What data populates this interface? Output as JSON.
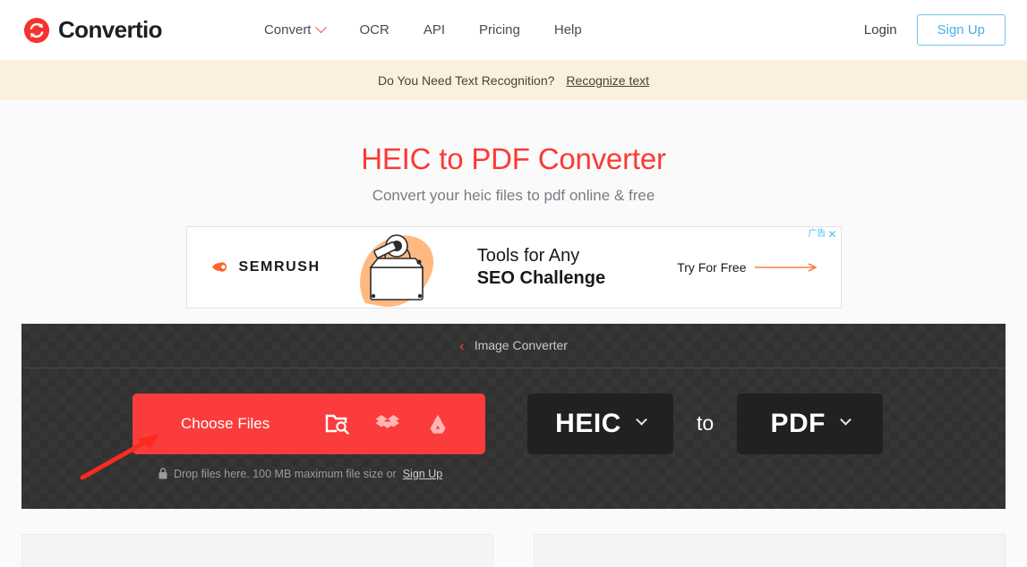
{
  "header": {
    "brand": "Convertio",
    "brand_icon": "convertio-logo-icon",
    "nav": [
      {
        "label": "Convert",
        "has_dropdown": true
      },
      {
        "label": "OCR",
        "has_dropdown": false
      },
      {
        "label": "API",
        "has_dropdown": false
      },
      {
        "label": "Pricing",
        "has_dropdown": false
      },
      {
        "label": "Help",
        "has_dropdown": false
      }
    ],
    "login_label": "Login",
    "signup_label": "Sign Up"
  },
  "ocr_banner": {
    "text": "Do You Need Text Recognition?",
    "link_label": "Recognize text"
  },
  "hero": {
    "title": "HEIC to PDF Converter",
    "subtitle": "Convert your heic files to pdf online & free"
  },
  "ad": {
    "label": "广告",
    "close_label": "✕",
    "brand": "SEMRUSH",
    "headline_line1": "Tools for Any",
    "headline_line2": "SEO Challenge",
    "cta": "Try For Free"
  },
  "converter": {
    "breadcrumb": "Image Converter",
    "choose_files_label": "Choose Files",
    "source_icons": [
      "folder-search-icon",
      "dropbox-icon",
      "google-drive-icon"
    ],
    "drop_text": "Drop files here. 100 MB maximum file size or",
    "drop_link": "Sign Up",
    "from_format": "HEIC",
    "to_word": "to",
    "to_format": "PDF"
  },
  "colors": {
    "accent_red": "#fb3a35",
    "button_red": "#fa3c3c",
    "signup_blue": "#49afe9",
    "banner_bg": "#faf0dd",
    "panel_dark": "#363636",
    "format_dark": "#212121"
  }
}
